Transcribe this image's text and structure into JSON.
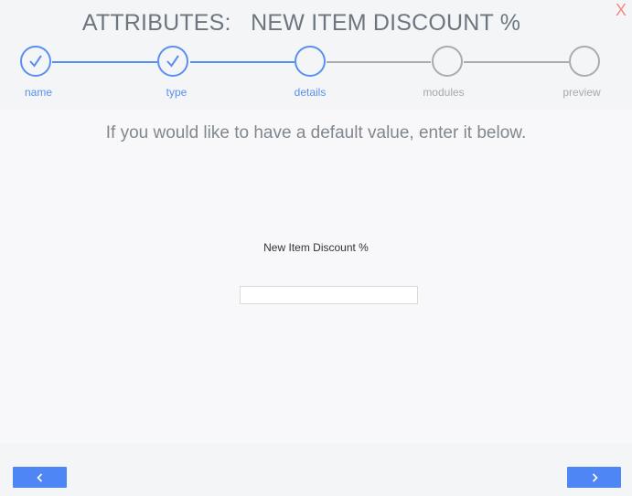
{
  "header": {
    "title": "ATTRIBUTES:   NEW ITEM DISCOUNT %",
    "close_label": "X"
  },
  "stepper": {
    "steps": [
      {
        "label": "name",
        "state": "completed"
      },
      {
        "label": "type",
        "state": "completed"
      },
      {
        "label": "details",
        "state": "current"
      },
      {
        "label": "modules",
        "state": "upcoming"
      },
      {
        "label": "preview",
        "state": "upcoming"
      }
    ]
  },
  "content": {
    "instruction": "If you would like to have a default value, enter it below.",
    "field_label": "New Item Discount %",
    "field_value": ""
  },
  "footer": {
    "back_icon": "chevron-left-icon",
    "next_icon": "chevron-right-icon"
  },
  "colors": {
    "accent": "#4f86f5",
    "step_active": "#5b8fef",
    "step_inactive": "#ababab",
    "close": "#f08a80"
  }
}
